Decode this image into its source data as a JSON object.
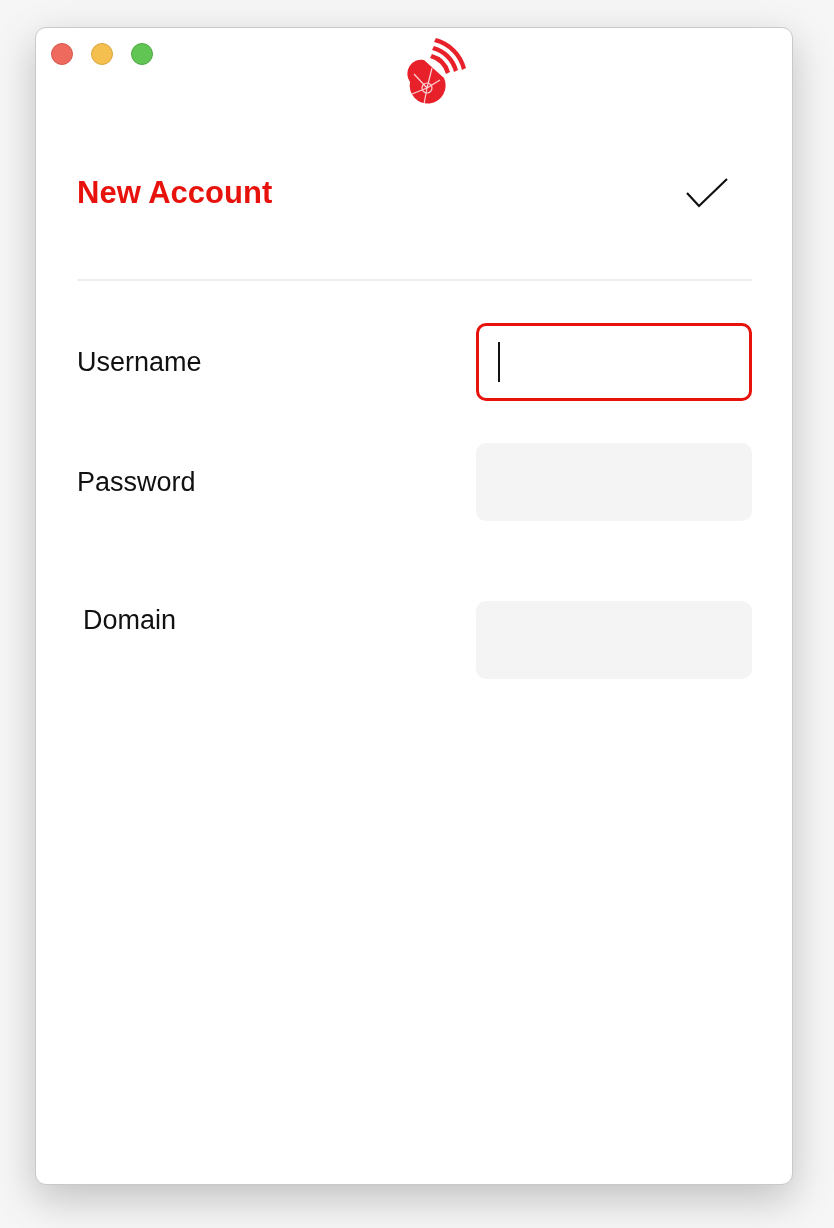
{
  "header": {
    "title": "New Account"
  },
  "fields": [
    {
      "label": "Username",
      "focused": true
    },
    {
      "label": "Password",
      "focused": false
    },
    {
      "label": "Domain",
      "focused": false
    }
  ]
}
